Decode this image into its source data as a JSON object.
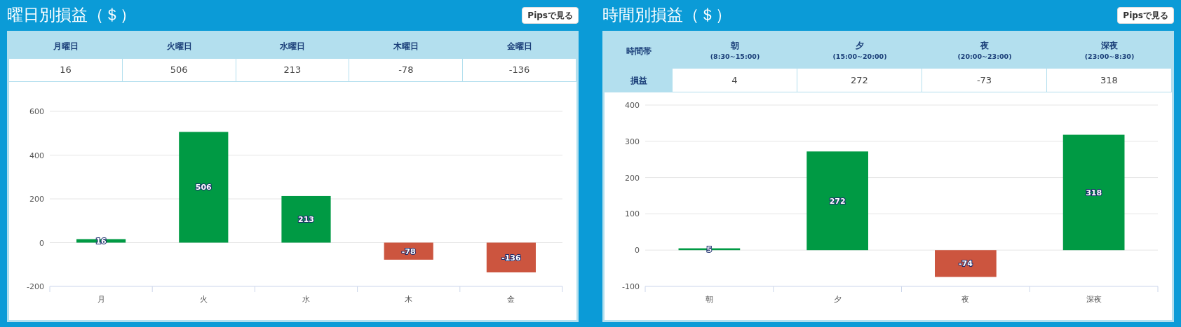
{
  "panels": [
    {
      "title": "曜日別損益（＄）",
      "button": "Pipsで見る",
      "table": {
        "kind": "weekday",
        "columns": [
          {
            "label": "月曜日",
            "value": "16"
          },
          {
            "label": "火曜日",
            "value": "506"
          },
          {
            "label": "水曜日",
            "value": "213"
          },
          {
            "label": "木曜日",
            "value": "-78"
          },
          {
            "label": "金曜日",
            "value": "-136"
          }
        ]
      },
      "chart_data": {
        "type": "bar",
        "categories": [
          "月",
          "火",
          "水",
          "木",
          "金"
        ],
        "series": [
          {
            "color": "#009a44",
            "values": [
              16,
              506,
              213,
              null,
              null
            ]
          },
          {
            "color": "#cc553f",
            "values": [
              null,
              null,
              null,
              -78,
              -136
            ]
          }
        ],
        "stacked": true,
        "grid": true,
        "ylim": [
          -200,
          600
        ],
        "yticks": [
          -200,
          0,
          200,
          400,
          600
        ],
        "value_labels": [
          "16",
          "506",
          "213",
          "-78",
          "-136"
        ]
      }
    },
    {
      "title": "時間別損益（＄）",
      "button": "Pipsで見る",
      "table": {
        "kind": "time",
        "row_headers": [
          "時間帯",
          "損益"
        ],
        "columns": [
          {
            "label": "朝",
            "range": "(8:30~15:00)",
            "value": "4"
          },
          {
            "label": "夕",
            "range": "(15:00~20:00)",
            "value": "272"
          },
          {
            "label": "夜",
            "range": "(20:00~23:00)",
            "value": "-73"
          },
          {
            "label": "深夜",
            "range": "(23:00~8:30)",
            "value": "318"
          }
        ]
      },
      "chart_data": {
        "type": "bar",
        "categories": [
          "朝",
          "夕",
          "夜",
          "深夜"
        ],
        "series": [
          {
            "color": "#009a44",
            "values": [
              5,
              272,
              null,
              318
            ]
          },
          {
            "color": "#cc553f",
            "values": [
              null,
              null,
              -74,
              null
            ]
          }
        ],
        "stacked": true,
        "grid": true,
        "ylim": [
          -100,
          400
        ],
        "yticks": [
          -100,
          0,
          100,
          200,
          300,
          400
        ],
        "value_labels": [
          "5",
          "272",
          "-74",
          "318"
        ]
      }
    }
  ]
}
